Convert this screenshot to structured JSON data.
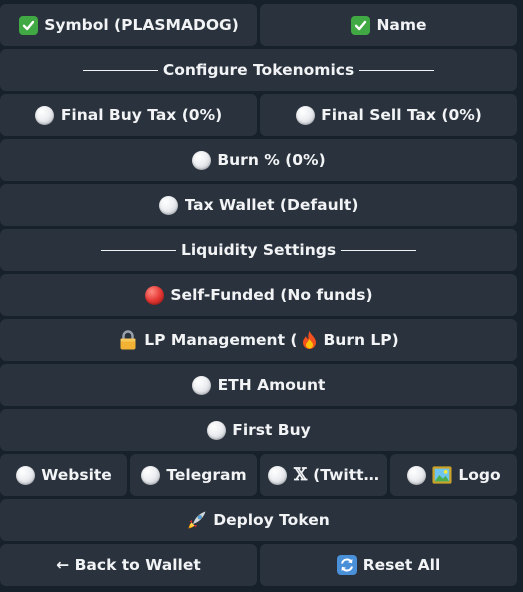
{
  "rows": [
    {
      "buttons": [
        {
          "label": "Symbol (PLASMADOG)",
          "icon": "check-icon"
        },
        {
          "label": "Name",
          "icon": "check-icon"
        }
      ]
    },
    {
      "buttons": [
        {
          "label": "Configure Tokenomics",
          "icon": "separator"
        }
      ]
    },
    {
      "buttons": [
        {
          "label": "Final Buy Tax (0%)",
          "icon": "white-circle-icon"
        },
        {
          "label": "Final Sell Tax (0%)",
          "icon": "white-circle-icon"
        }
      ]
    },
    {
      "buttons": [
        {
          "label": "Burn % (0%)",
          "icon": "white-circle-icon"
        }
      ]
    },
    {
      "buttons": [
        {
          "label": "Tax Wallet (Default)",
          "icon": "white-circle-icon"
        }
      ]
    },
    {
      "buttons": [
        {
          "label": "Liquidity Settings",
          "icon": "separator"
        }
      ]
    },
    {
      "buttons": [
        {
          "label": "Self-Funded (No funds)",
          "icon": "red-circle-icon"
        }
      ]
    },
    {
      "buttons": [
        {
          "label_pre": "LP Management (",
          "label_post": "Burn LP)",
          "icon": "lock-icon",
          "inner_icon": "fire-icon"
        }
      ]
    },
    {
      "buttons": [
        {
          "label": "ETH Amount",
          "icon": "white-circle-icon"
        }
      ]
    },
    {
      "buttons": [
        {
          "label": "First Buy",
          "icon": "white-circle-icon"
        }
      ]
    },
    {
      "buttons": [
        {
          "label": "Website",
          "icon": "white-circle-icon"
        },
        {
          "label": "Telegram",
          "icon": "white-circle-icon"
        },
        {
          "label": "(Twitt…",
          "icon": "white-circle-icon",
          "glyph": "𝕏"
        },
        {
          "label": "Logo",
          "icon": "white-circle-icon",
          "second_icon": "picture-icon"
        }
      ]
    },
    {
      "buttons": [
        {
          "label": "Deploy Token",
          "icon": "rocket-icon"
        }
      ]
    },
    {
      "buttons": [
        {
          "label": "← Back to Wallet",
          "icon": "none"
        },
        {
          "label": "Reset All",
          "icon": "refresh-icon"
        }
      ]
    }
  ]
}
